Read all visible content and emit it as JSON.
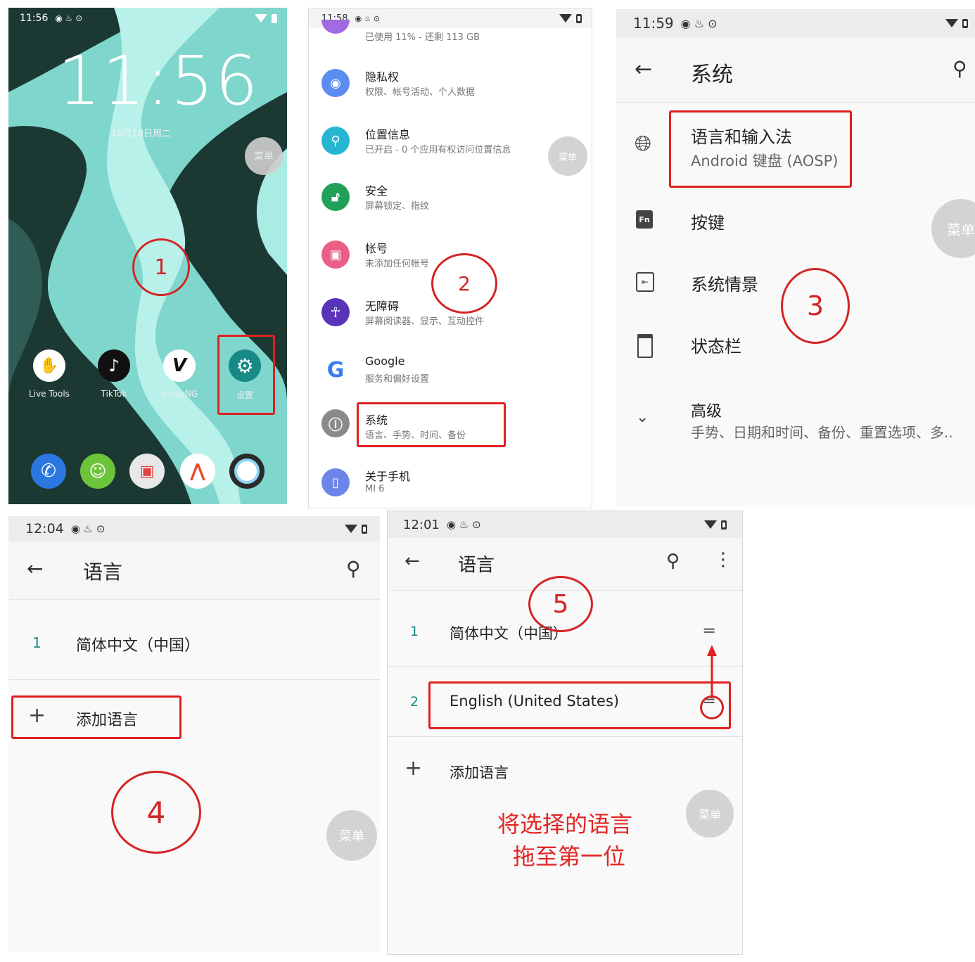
{
  "p1": {
    "time": "11:56",
    "clock": "11:56",
    "date": "10月18日周二",
    "fab": "菜单",
    "apps": [
      "Live Tools",
      "TikTok",
      "v2rayNG",
      "设置"
    ],
    "step": "1",
    "colors": {
      "bg": "#17302c",
      "accent": "#9fe3db"
    }
  },
  "p2": {
    "time": "11:58",
    "storage_sub": "已使用 11% - 还剩 113 GB",
    "items": [
      {
        "title": "隐私权",
        "sub": "权限、帐号活动、个人数据",
        "icon": "eye-icon",
        "color": "#5b8df0"
      },
      {
        "title": "位置信息",
        "sub": "已开启 - 0 个应用有权访问位置信息",
        "icon": "location-pin-icon",
        "color": "#26b6d2"
      },
      {
        "title": "安全",
        "sub": "屏幕锁定、指纹",
        "icon": "lock-icon",
        "color": "#21a05a"
      },
      {
        "title": "帐号",
        "sub": "未添加任何帐号",
        "icon": "account-icon",
        "color": "#ea5f86"
      },
      {
        "title": "无障碍",
        "sub": "屏幕阅读器、显示、互动控件",
        "icon": "accessibility-icon",
        "color": "#5a34b8"
      },
      {
        "title": "Google",
        "sub": "服务和偏好设置",
        "icon": "google-icon",
        "color": "#ffffff"
      },
      {
        "title": "系统",
        "sub": "语言、手势、时间、备份",
        "icon": "info-icon",
        "color": "#8a8a8a"
      },
      {
        "title": "关于手机",
        "sub": "MI 6",
        "icon": "phone-info-icon",
        "color": "#6b86e8"
      }
    ],
    "fab": "菜单",
    "step": "2"
  },
  "p3": {
    "time": "11:59",
    "title": "系统",
    "items": [
      {
        "title": "语言和输入法",
        "sub": "Android 键盘 (AOSP)",
        "icon": "globe-icon"
      },
      {
        "title": "按键",
        "sub": "",
        "icon": "fn-key-icon"
      },
      {
        "title": "系统情景",
        "sub": "",
        "icon": "system-scene-icon"
      },
      {
        "title": "状态栏",
        "sub": "",
        "icon": "status-bar-icon"
      },
      {
        "title": "高级",
        "sub": "手势、日期和时间、备份、重置选项、多..",
        "icon": "chevron-down-icon"
      }
    ],
    "fab": "菜单",
    "step": "3"
  },
  "p4": {
    "time": "12:04",
    "title": "语言",
    "lang_num": "1",
    "lang": "简体中文（中国）",
    "add": "添加语言",
    "fab": "菜单",
    "step": "4"
  },
  "p5": {
    "time": "12:01",
    "title": "语言",
    "langs": [
      {
        "num": "1",
        "name": "简体中文（中国）"
      },
      {
        "num": "2",
        "name": "English (United States)"
      }
    ],
    "add": "添加语言",
    "note1": "将选择的语言",
    "note2": "拖至第一位",
    "fab": "菜单",
    "step": "5"
  }
}
